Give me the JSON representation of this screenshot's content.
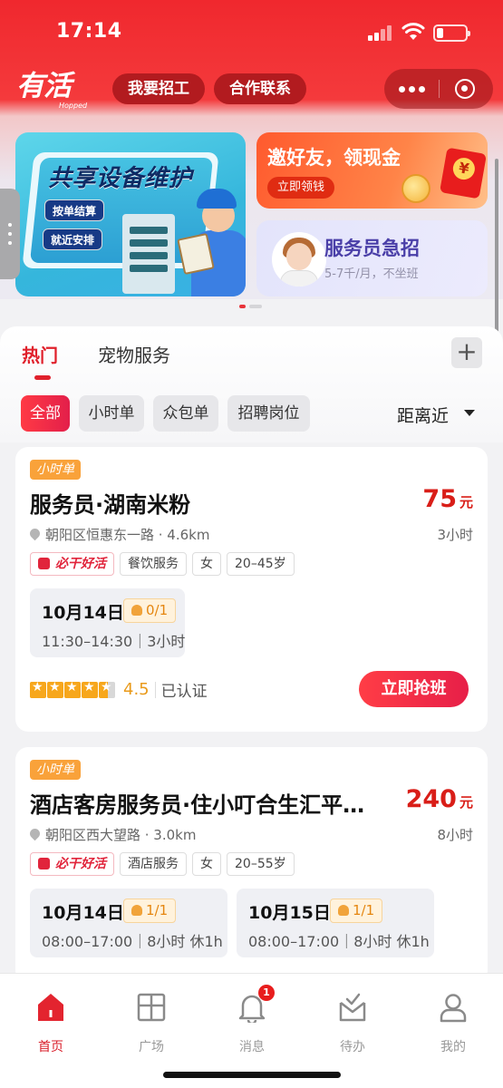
{
  "status_bar": {
    "time": "17:14"
  },
  "nav": {
    "logo_text": "有活",
    "logo_sub": "Hopped",
    "recruit_label": "我要招工",
    "contact_label": "合作联系"
  },
  "banners": {
    "main": {
      "title": "共享设备维护",
      "tags": [
        "按单结算",
        "就近安排"
      ]
    },
    "invite": {
      "title": "邀好友，领现金",
      "button": "立即领钱",
      "coin_symbol": "¥"
    },
    "hire": {
      "title": "服务员急招",
      "subtitle": "5-7千/月，不坐班"
    }
  },
  "tabs": {
    "active": "热门",
    "inactive": "宠物服务",
    "add_symbol": "+"
  },
  "filters": {
    "chips": [
      "全部",
      "小时单",
      "众包单",
      "招聘岗位"
    ],
    "active_index": 0,
    "sort": "距离近"
  },
  "jobs": [
    {
      "type": "小时单",
      "title": "服务员·湖南米粉",
      "price": "75",
      "price_unit": "元",
      "location": "朝阳区恒惠东一路 · 4.6km",
      "hours": "3小时",
      "tags": [
        "必干好活",
        "餐饮服务",
        "女",
        "20–45岁"
      ],
      "shifts": [
        {
          "date": "10月14日",
          "slots": "0/1",
          "time": "11:30–14:30｜3小时"
        }
      ],
      "rating": {
        "stars": 4.5,
        "score": "4.5",
        "verified": "已认证"
      },
      "action": "立即抢班"
    },
    {
      "type": "小时单",
      "title": "酒店客房服务员·住小叮合生汇平…",
      "price": "240",
      "price_unit": "元",
      "location": "朝阳区西大望路 · 3.0km",
      "hours": "8小时",
      "tags": [
        "必干好活",
        "酒店服务",
        "女",
        "20–55岁"
      ],
      "shifts": [
        {
          "date": "10月14日",
          "slots": "1/1",
          "time": "08:00–17:00｜8小时 休1h"
        },
        {
          "date": "10月15日",
          "slots": "1/1",
          "time": "08:00–17:00｜8小时 休1h"
        }
      ]
    }
  ],
  "tabbar": {
    "items": [
      {
        "label": "首页",
        "icon": "home-icon",
        "active": true
      },
      {
        "label": "广场",
        "icon": "grid-icon"
      },
      {
        "label": "消息",
        "icon": "bell-icon",
        "badge": "1"
      },
      {
        "label": "待办",
        "icon": "inbox-check-icon"
      },
      {
        "label": "我的",
        "icon": "user-icon"
      }
    ]
  },
  "colors": {
    "brand_red": "#f0282e",
    "price_red": "#d91e18",
    "badge_orange": "#f9a23a"
  }
}
